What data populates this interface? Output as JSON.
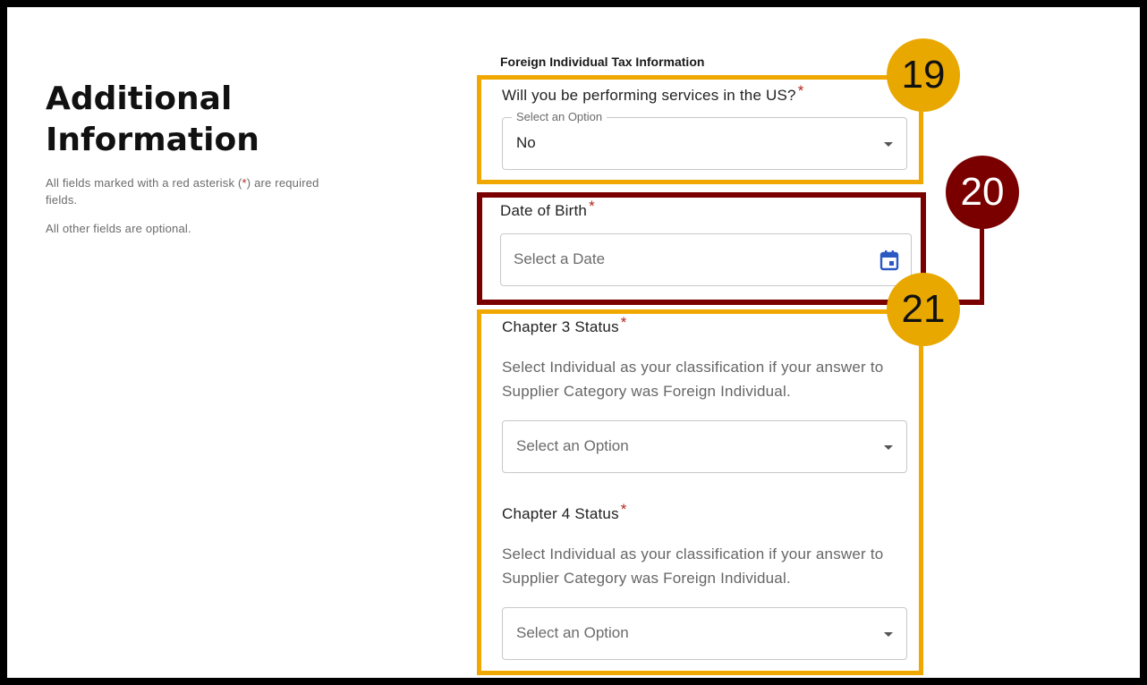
{
  "left": {
    "title_line1": "Additional",
    "title_line2": "Information",
    "note1_pre": "All fields marked with a red asterisk (",
    "note1_ast": "*",
    "note1_post": ") are required fields.",
    "note2": "All other fields are optional."
  },
  "form": {
    "section_title": "Foreign Individual Tax Information",
    "required_marker": "*",
    "services_us": {
      "label": "Will you be performing services in the US?",
      "floating_label": "Select an Option",
      "value": "No"
    },
    "date_of_birth": {
      "label": "Date of Birth",
      "placeholder": "Select a Date",
      "icon": "calendar-icon"
    },
    "chapter3": {
      "label": "Chapter 3 Status",
      "helper": "Select Individual as your classification if your answer to Supplier Category was Foreign Individual.",
      "placeholder": "Select an Option"
    },
    "chapter4": {
      "label": "Chapter 4 Status",
      "helper": "Select Individual as your classification if your answer to Supplier Category was Foreign Individual.",
      "placeholder": "Select an Option"
    }
  },
  "annotations": {
    "badge_19": "19",
    "badge_20": "20",
    "badge_21": "21",
    "colors": {
      "yellow": "#f0a800",
      "dark_red": "#7a0000"
    }
  }
}
